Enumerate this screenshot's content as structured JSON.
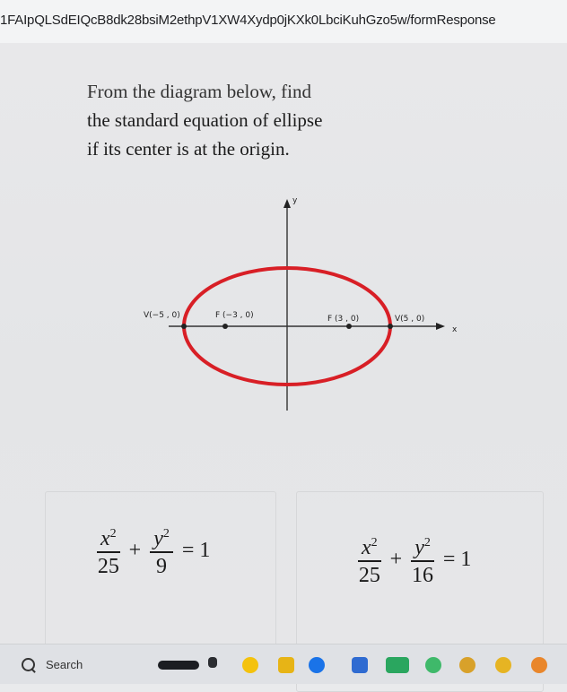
{
  "browser": {
    "url": "1FAIpQLSdEIQcB8dk28bsiM2ethpV1XW4Xydp0jKXk0LbciKuhGzo5w/formResponse"
  },
  "question": {
    "line1": "From the diagram below, find",
    "line2": "the standard equation of ellipse",
    "line3": "if its center is at the origin."
  },
  "diagram": {
    "y_axis_label": "y",
    "x_axis_label": "x",
    "points": [
      {
        "name": "V",
        "label": "V(−5 , 0)"
      },
      {
        "name": "F",
        "label": "F (−3 , 0)"
      },
      {
        "name": "F",
        "label": "F (3 , 0)"
      },
      {
        "name": "V",
        "label": "V(5 , 0)"
      }
    ]
  },
  "choices": [
    {
      "num_var": "x",
      "num_exp": "2",
      "den1": "25",
      "plus": "+",
      "num2_var": "y",
      "num2_exp": "2",
      "den2": "9",
      "eq": "= 1"
    },
    {
      "num_var": "x",
      "num_exp": "2",
      "den1": "25",
      "plus": "+",
      "num2_var": "y",
      "num2_exp": "2",
      "den2": "16",
      "eq": "= 1"
    }
  ],
  "taskbar": {
    "search_label": "Search",
    "icons": [
      "search-icon",
      "task-view-icon",
      "chrome-icon",
      "file-explorer-icon",
      "edge-icon",
      "store-icon",
      "app-icon",
      "app-icon-2"
    ]
  }
}
